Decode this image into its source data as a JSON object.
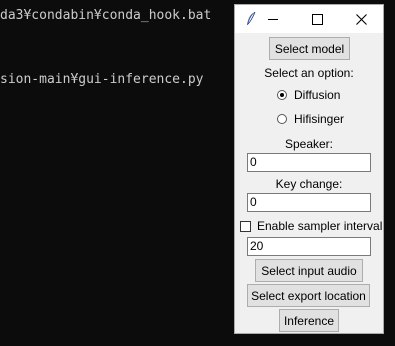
{
  "console": {
    "lines": [
      "da3¥condabin¥conda_hook.bat",
      "sion-main¥gui-inference.py"
    ]
  },
  "window": {
    "icon": "feather-icon",
    "controls": {
      "minimize": "minimize-icon",
      "maximize": "maximize-icon",
      "close": "close-icon"
    }
  },
  "form": {
    "select_model_label": "Select model",
    "option_prompt": "Select an option:",
    "options": [
      {
        "label": "Diffusion",
        "checked": true
      },
      {
        "label": "Hifisinger",
        "checked": false
      }
    ],
    "speaker_label": "Speaker:",
    "speaker_value": "0",
    "key_change_label": "Key change:",
    "key_change_value": "0",
    "sampler_interval_label": "Enable sampler interval",
    "sampler_interval_checked": false,
    "sampler_interval_value": "20",
    "select_input_audio_label": "Select input audio",
    "select_export_location_label": "Select export location",
    "inference_label": "Inference"
  },
  "colors": {
    "console_bg": "#0c0c0c",
    "console_text": "#cccccc",
    "window_bg": "#f0f0f0",
    "button_bg": "#e1e1e1"
  }
}
